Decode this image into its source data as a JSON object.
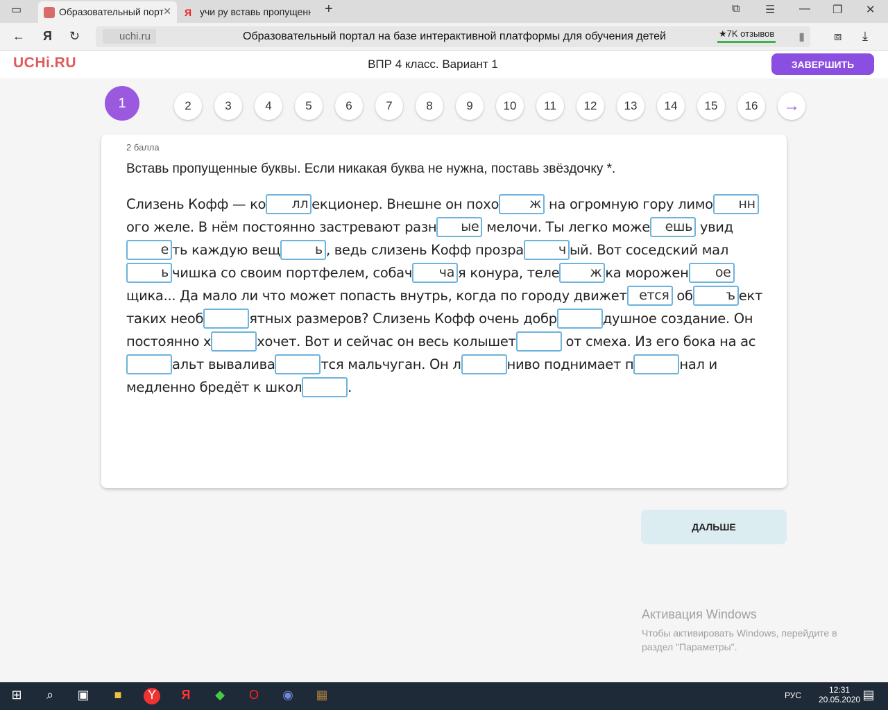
{
  "browser": {
    "tabs": [
      {
        "title": "Образовательный порт"
      },
      {
        "title": "учи ру вставь пропущенн"
      }
    ],
    "domain": "uchi.ru",
    "page_title": "Образовательный портал на базе интерактивной платформы для обучения детей",
    "reviews": "★7K отзывов"
  },
  "header": {
    "logo": "UCHi.RU",
    "title": "ВПР 4 класс. Вариант 1",
    "finish": "ЗАВЕРШИТЬ"
  },
  "pager": {
    "pages": [
      "1",
      "2",
      "3",
      "4",
      "5",
      "6",
      "7",
      "8",
      "9",
      "10",
      "11",
      "12",
      "13",
      "14",
      "15",
      "16"
    ],
    "current": "1",
    "next_icon": "→"
  },
  "task": {
    "points": "2 балла",
    "instruction": "Вставь пропущенные буквы. Если никакая буква не нужна, поставь звёздочку *.",
    "lines": [
      [
        {
          "t": "Слизень Кофф — ко"
        },
        {
          "in": "лл"
        },
        {
          "t": "екционер. Внешне он похо"
        },
        {
          "in": "ж"
        },
        {
          "t": " на огромную гору лимо"
        },
        {
          "in": "нн"
        }
      ],
      [
        {
          "t": "ого желе. В нём постоянно застревают разн"
        },
        {
          "in": "ые"
        },
        {
          "t": " мелочи. Ты легко може"
        },
        {
          "in": "ешь"
        },
        {
          "t": " увид"
        }
      ],
      [
        {
          "in": "е"
        },
        {
          "t": "ть каждую вещ"
        },
        {
          "in": "ь"
        },
        {
          "t": ", ведь слизень Кофф прозра"
        },
        {
          "in": "ч"
        },
        {
          "t": "ый. Вот соседский мал"
        }
      ],
      [
        {
          "in": "ь"
        },
        {
          "t": "чишка со своим портфелем, собач"
        },
        {
          "in": "ча"
        },
        {
          "t": "я конура, теле"
        },
        {
          "in": "ж"
        },
        {
          "t": "ка морожен"
        },
        {
          "in": "ое"
        }
      ],
      [
        {
          "t": "щика... Да мало ли что может попасть внутрь, когда по городу движет"
        },
        {
          "in": "ется"
        },
        {
          "t": " об"
        },
        {
          "in": "ъ"
        },
        {
          "t": "ект"
        }
      ],
      [
        {
          "t": "таких необ"
        },
        {
          "in": ""
        },
        {
          "t": "ятных размеров? Слизень Кофф очень добр"
        },
        {
          "in": ""
        },
        {
          "t": "душное создание. Он"
        }
      ],
      [
        {
          "t": "постоянно х"
        },
        {
          "in": ""
        },
        {
          "t": "хочет. Вот и сейчас он весь колышет"
        },
        {
          "in": ""
        },
        {
          "t": " от смеха. Из его бока на ас"
        }
      ],
      [
        {
          "in": ""
        },
        {
          "t": "альт вывалива"
        },
        {
          "in": ""
        },
        {
          "t": "тся мальчуган. Он л"
        },
        {
          "in": ""
        },
        {
          "t": "ниво поднимает п"
        },
        {
          "in": ""
        },
        {
          "t": "нал и"
        }
      ],
      [
        {
          "t": "медленно бредёт к школ"
        },
        {
          "in": ""
        },
        {
          "t": "."
        }
      ]
    ]
  },
  "next": "ДАЛЬШЕ",
  "activation": {
    "title": "Активация Windows",
    "text": "Чтобы активировать Windows, перейдите в раздел \"Параметры\"."
  },
  "taskbar": {
    "lang": "РУС",
    "time": "12:31",
    "date": "20.05.2020"
  }
}
